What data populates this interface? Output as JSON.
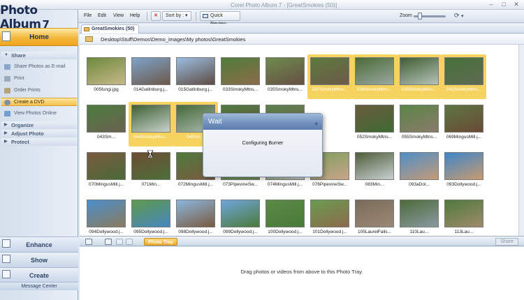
{
  "app": {
    "logo_name": "Photo Album",
    "logo_version": "7",
    "window_title": "Corel Photo Album 7 - [GreatSmokies (50)]"
  },
  "menu": {
    "file": "File",
    "edit": "Edit",
    "view": "View",
    "help": "Help"
  },
  "toolbar": {
    "sort_label": "Sort by :",
    "quick_review_label": "Quick Review",
    "zoom_label": "Zoom"
  },
  "sidebar": {
    "home": "Home",
    "share_header": "Share",
    "share_items": [
      "Share Photos as E-mail",
      "Print",
      "Order Prints",
      "Create a DVD",
      "View Photos Online"
    ],
    "organize": "Organize",
    "adjust": "Adjust Photo",
    "protect": "Protect",
    "enhance": "Enhance",
    "show": "Show",
    "create": "Create",
    "message_center": "Message Center"
  },
  "tabs": [
    {
      "label": "GreatSmokies (50)"
    }
  ],
  "path": "Desktop\\Stuff\\Demos\\Demo_images\\My photos\\GreatSmokies",
  "thumbnails": [
    {
      "caption": "005fungi.jpg",
      "selected": false,
      "colors": [
        "#6d8a3c",
        "#c7b88a"
      ]
    },
    {
      "caption": "014Gatlinburg.j...",
      "selected": false,
      "colors": [
        "#7fa2c9",
        "#6b5a4c"
      ]
    },
    {
      "caption": "015Gatlinburg.j...",
      "selected": false,
      "colors": [
        "#9cbde0",
        "#5d4c44"
      ]
    },
    {
      "caption": "033SmokyMtns...",
      "selected": false,
      "colors": [
        "#4f7d3a",
        "#8c6b4a"
      ]
    },
    {
      "caption": "035SmokyMtns...",
      "selected": false,
      "colors": [
        "#6e8b4d",
        "#665044"
      ]
    },
    {
      "caption": "037SmokyMtns...",
      "selected": true,
      "colors": [
        "#5c7a3e",
        "#6e5a48"
      ]
    },
    {
      "caption": "038SmokyMtns...",
      "selected": true,
      "colors": [
        "#4b6a36",
        "#9aa8a0"
      ]
    },
    {
      "caption": "039SmokyMtns...",
      "selected": true,
      "colors": [
        "#3f5e32",
        "#b5c2b8"
      ]
    },
    {
      "caption": "042SmokyMtns...",
      "selected": true,
      "colors": [
        "#47713a",
        "#5e6b52"
      ]
    },
    {
      "caption": "043Sm...",
      "selected": false,
      "colors": [
        "#4c7c3e",
        "#6b6150"
      ]
    },
    {
      "caption": "044SmokyMtns...",
      "selected": true,
      "colors": [
        "#3d6033",
        "#c9d2cc"
      ]
    },
    {
      "caption": "045Sm...",
      "selected": true,
      "colors": [
        "#456a38",
        "#a9b8ad"
      ]
    },
    {
      "caption": "",
      "selected": false,
      "colors": [
        "#4e7a3d",
        "#6a5b49"
      ]
    },
    {
      "caption": "",
      "selected": false,
      "colors": [
        "#58804a",
        "#7a6b55"
      ]
    },
    {
      "caption": "052SmokyMtns...",
      "selected": false,
      "colors": [
        "#6a5b3e",
        "#3f6a33"
      ]
    },
    {
      "caption": "055SmokyMtns...",
      "selected": false,
      "colors": [
        "#5b8646",
        "#8a7a6a"
      ]
    },
    {
      "caption": "069MingusMill.j...",
      "selected": false,
      "colors": [
        "#5d7642",
        "#6a4a36"
      ]
    },
    {
      "caption": "070MingusMill.j...",
      "selected": false,
      "colors": [
        "#7a5a40",
        "#4a6a36"
      ]
    },
    {
      "caption": "071Min...",
      "selected": false,
      "colors": [
        "#6e4c34",
        "#4b7038"
      ]
    },
    {
      "caption": "072MingusMill.j...",
      "selected": false,
      "colors": [
        "#4f7a3c",
        "#7a5a40"
      ]
    },
    {
      "caption": "073PipevineSw...",
      "selected": false,
      "colors": [
        "#5b8a44",
        "#6e8e54"
      ]
    },
    {
      "caption": "074MingusMill.j...",
      "selected": false,
      "colors": [
        "#4a6e38",
        "#c8cfc4"
      ]
    },
    {
      "caption": "076PipevineSw...",
      "selected": false,
      "colors": [
        "#7e9e5c",
        "#c9a48a"
      ]
    },
    {
      "caption": "083Min...",
      "selected": false,
      "colors": [
        "#4e5e38",
        "#c8d0d2"
      ]
    },
    {
      "caption": "093aDol...",
      "selected": false,
      "colors": [
        "#4f8ec7",
        "#c49a78"
      ]
    },
    {
      "caption": "093Dollywood.j...",
      "selected": false,
      "colors": [
        "#3f86c8",
        "#c79a70"
      ]
    },
    {
      "caption": "094Dollywood.j...",
      "selected": false,
      "colors": [
        "#4b8fcc",
        "#8a7a5c"
      ]
    },
    {
      "caption": "095Dollywood.j...",
      "selected": false,
      "colors": [
        "#5e9a4c",
        "#4686c0"
      ]
    },
    {
      "caption": "098Dollywood.j...",
      "selected": false,
      "colors": [
        "#8cb6de",
        "#7a5a40"
      ]
    },
    {
      "caption": "099Dollywood.j...",
      "selected": false,
      "colors": [
        "#6ea6dc",
        "#4b7a3a"
      ]
    },
    {
      "caption": "100Dollywood.j...",
      "selected": false,
      "colors": [
        "#5a8a44",
        "#4a7a38"
      ]
    },
    {
      "caption": "101Dollywood.j...",
      "selected": false,
      "colors": [
        "#6a9c50",
        "#8c6a4c"
      ]
    },
    {
      "caption": "105LaurelFalls...",
      "selected": false,
      "colors": [
        "#7a6a5a",
        "#9a8a74"
      ]
    },
    {
      "caption": "110Lau...",
      "selected": false,
      "colors": [
        "#4d6a3a",
        "#8a9aa0"
      ]
    },
    {
      "caption": "113Lau...",
      "selected": false,
      "colors": [
        "#4f7a3c",
        "#a08a6a"
      ]
    }
  ],
  "tray": {
    "tab_label": "Photo Tray",
    "share_label": "Share",
    "hint": "Drag photos or videos from above to this Photo Tray."
  },
  "dialog": {
    "title": "Wait",
    "close": "×",
    "message": "Configuring Burner"
  }
}
